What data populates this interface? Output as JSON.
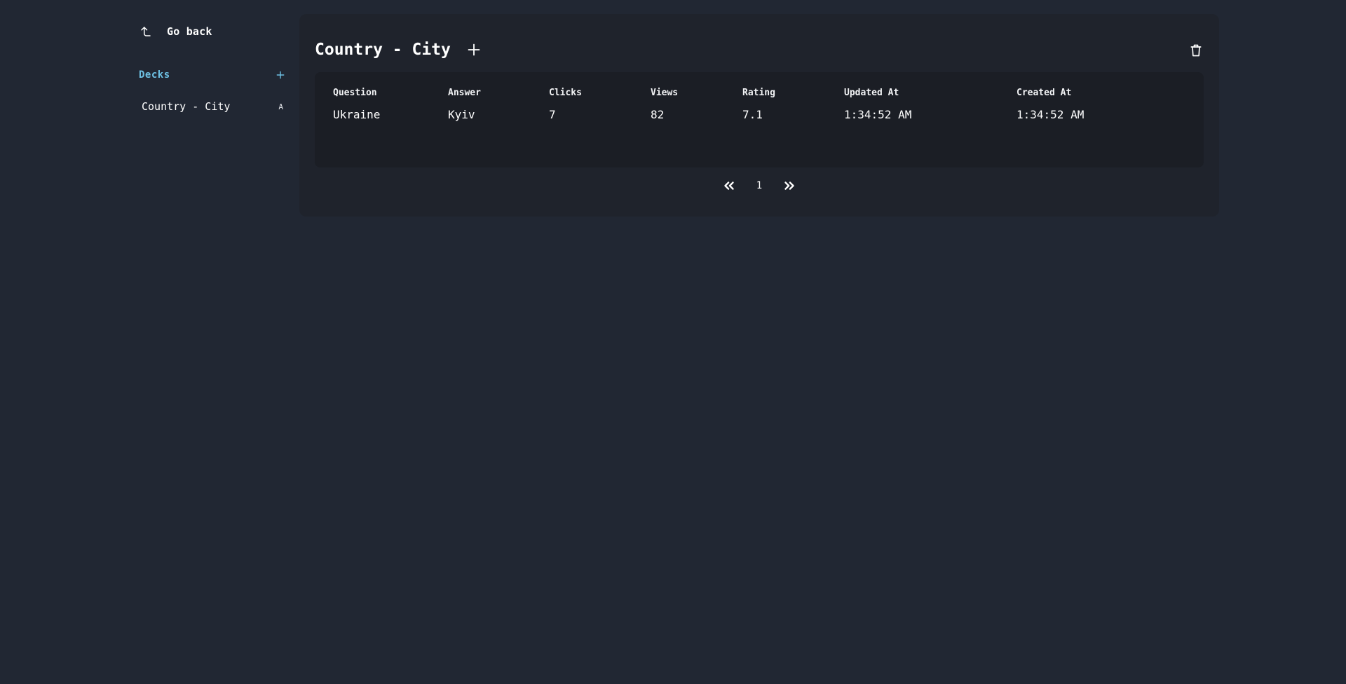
{
  "sidebar": {
    "go_back": {
      "label": "Go back",
      "icon": "corner-left-up-icon"
    },
    "decks_title": "Decks",
    "decks_add_icon": "plus-icon",
    "items": [
      {
        "label": "Country - City",
        "badge": "A"
      }
    ]
  },
  "deck": {
    "title": "Country - City",
    "add_icon": "plus-icon",
    "delete_icon": "trash-icon"
  },
  "table": {
    "columns": [
      "Question",
      "Answer",
      "Clicks",
      "Views",
      "Rating",
      "Updated At",
      "Created At"
    ],
    "rows": [
      [
        "Ukraine",
        "Kyiv",
        "7",
        "82",
        "7.1",
        "1:34:52 AM",
        "1:34:52 AM"
      ]
    ]
  },
  "pagination": {
    "prev_icon": "chevrons-left-icon",
    "next_icon": "chevrons-right-icon",
    "current_page": "1"
  },
  "colors": {
    "background": "#212733",
    "panel": "#1f232c",
    "table": "#1b1e25",
    "accent": "#6ec1e4"
  }
}
